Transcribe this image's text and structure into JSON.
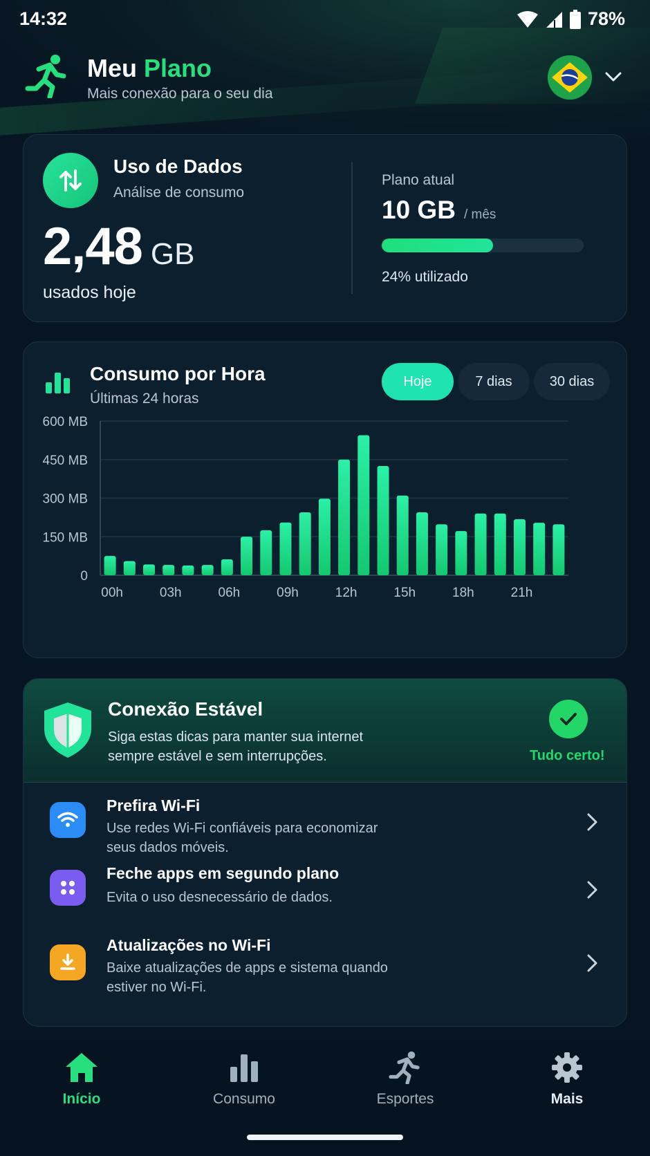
{
  "status_bar": {
    "time": "14:32",
    "battery": "78%"
  },
  "header": {
    "title_part1": "Meu ",
    "title_part2": "Plano",
    "subtitle": "Mais conexão para o seu dia"
  },
  "usage": {
    "title": "Uso de Dados",
    "subtitle": "Análise de consumo",
    "value": "2,48",
    "unit": "GB",
    "caption": "usados hoje",
    "plan_label": "Plano atual",
    "plan_value": "10 GB",
    "plan_period": "/ mês",
    "plan_used_fraction": 0.24,
    "plan_used_text": "24% utilizado"
  },
  "hourly": {
    "title": "Consumo por Hora",
    "subtitle": "Últimas 24 horas",
    "tabs": [
      {
        "label": "Hoje",
        "active": true
      },
      {
        "label": "7 dias",
        "active": false
      },
      {
        "label": "30 dias",
        "active": false
      }
    ]
  },
  "chart_data": {
    "type": "bar",
    "categories": [
      "00h",
      "01h",
      "02h",
      "03h",
      "04h",
      "05h",
      "06h",
      "07h",
      "08h",
      "09h",
      "10h",
      "11h",
      "12h",
      "13h",
      "14h",
      "15h",
      "16h",
      "17h",
      "18h",
      "19h",
      "20h",
      "21h",
      "22h",
      "23h"
    ],
    "values": [
      75,
      55,
      42,
      40,
      38,
      40,
      62,
      150,
      175,
      205,
      245,
      298,
      450,
      545,
      425,
      310,
      245,
      198,
      172,
      240,
      240,
      218,
      204,
      198
    ],
    "y_ticks": [
      "600 MB",
      "450 MB",
      "300 MB",
      "150 MB",
      "0"
    ],
    "x_ticks": [
      "00h",
      "03h",
      "06h",
      "09h",
      "12h",
      "15h",
      "18h",
      "21h"
    ],
    "ylim": [
      0,
      600
    ],
    "grid": true,
    "bar_color": "#22e39a"
  },
  "tips": {
    "title": "Conexão Estável",
    "description": "Siga estas dicas para manter sua internet sempre estável e sem interrupções.",
    "status": "Tudo certo!",
    "items": [
      {
        "icon": "wifi-icon",
        "color": "#2b8cf6",
        "title": "Prefira Wi-Fi",
        "description": "Use redes Wi-Fi confiáveis para economizar seus dados móveis."
      },
      {
        "icon": "apps-icon",
        "color": "#7b5cf0",
        "title": "Feche apps em segundo plano",
        "description": "Evita o uso desnecessário de dados."
      },
      {
        "icon": "download-icon",
        "color": "#f5a623",
        "title": "Atualizações no Wi-Fi",
        "description": "Baixe atualizações de apps e sistema quando estiver no Wi-Fi."
      }
    ]
  },
  "nav": {
    "items": [
      {
        "label": "Início",
        "icon": "home-icon",
        "active": true
      },
      {
        "label": "Consumo",
        "icon": "bar-chart-icon",
        "active": false
      },
      {
        "label": "Esportes",
        "icon": "runner-icon",
        "active": false
      },
      {
        "label": "Mais",
        "icon": "gear-icon",
        "active": false
      }
    ]
  },
  "colors": {
    "accent": "#25e07c",
    "background": "#071522",
    "card": "#0c1f2e"
  }
}
